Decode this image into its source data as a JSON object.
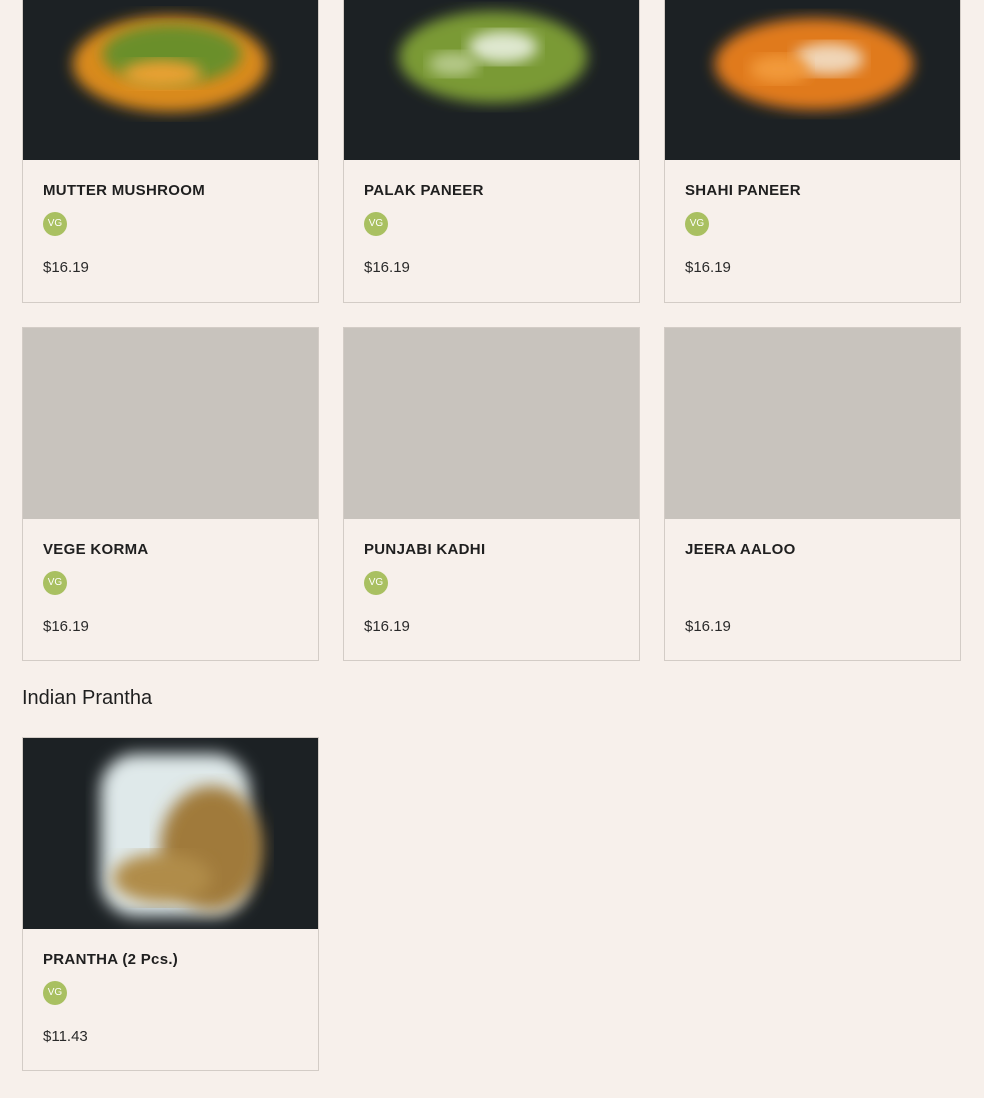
{
  "menu_rows": [
    {
      "items": [
        {
          "name": "MUTTER MUSHROOM",
          "badge": "VG",
          "price": "$16.19",
          "image": "mutter-mushroom-photo"
        },
        {
          "name": "PALAK PANEER",
          "badge": "VG",
          "price": "$16.19",
          "image": "palak-paneer-photo"
        },
        {
          "name": "SHAHI PANEER",
          "badge": "VG",
          "price": "$16.19",
          "image": "shahi-paneer-photo"
        }
      ]
    },
    {
      "items": [
        {
          "name": "VEGE KORMA",
          "badge": "VG",
          "price": "$16.19",
          "image": "placeholder"
        },
        {
          "name": "PUNJABI KADHI",
          "badge": "VG",
          "price": "$16.19",
          "image": "placeholder"
        },
        {
          "name": "JEERA AALOO",
          "badge": "",
          "price": "$16.19",
          "image": "placeholder"
        }
      ]
    }
  ],
  "sections": [
    {
      "title": "Indian Prantha",
      "items": [
        {
          "name": "PRANTHA (2 Pcs.)",
          "badge": "VG",
          "price": "$11.43",
          "image": "prantha-photo"
        }
      ]
    }
  ],
  "colors": {
    "page_background": "#f7f0eb",
    "card_border": "#d3ccc6",
    "vegan_badge": "#a9c061",
    "image_placeholder": "#c8c3bd",
    "photo_background": "#1c2124"
  }
}
